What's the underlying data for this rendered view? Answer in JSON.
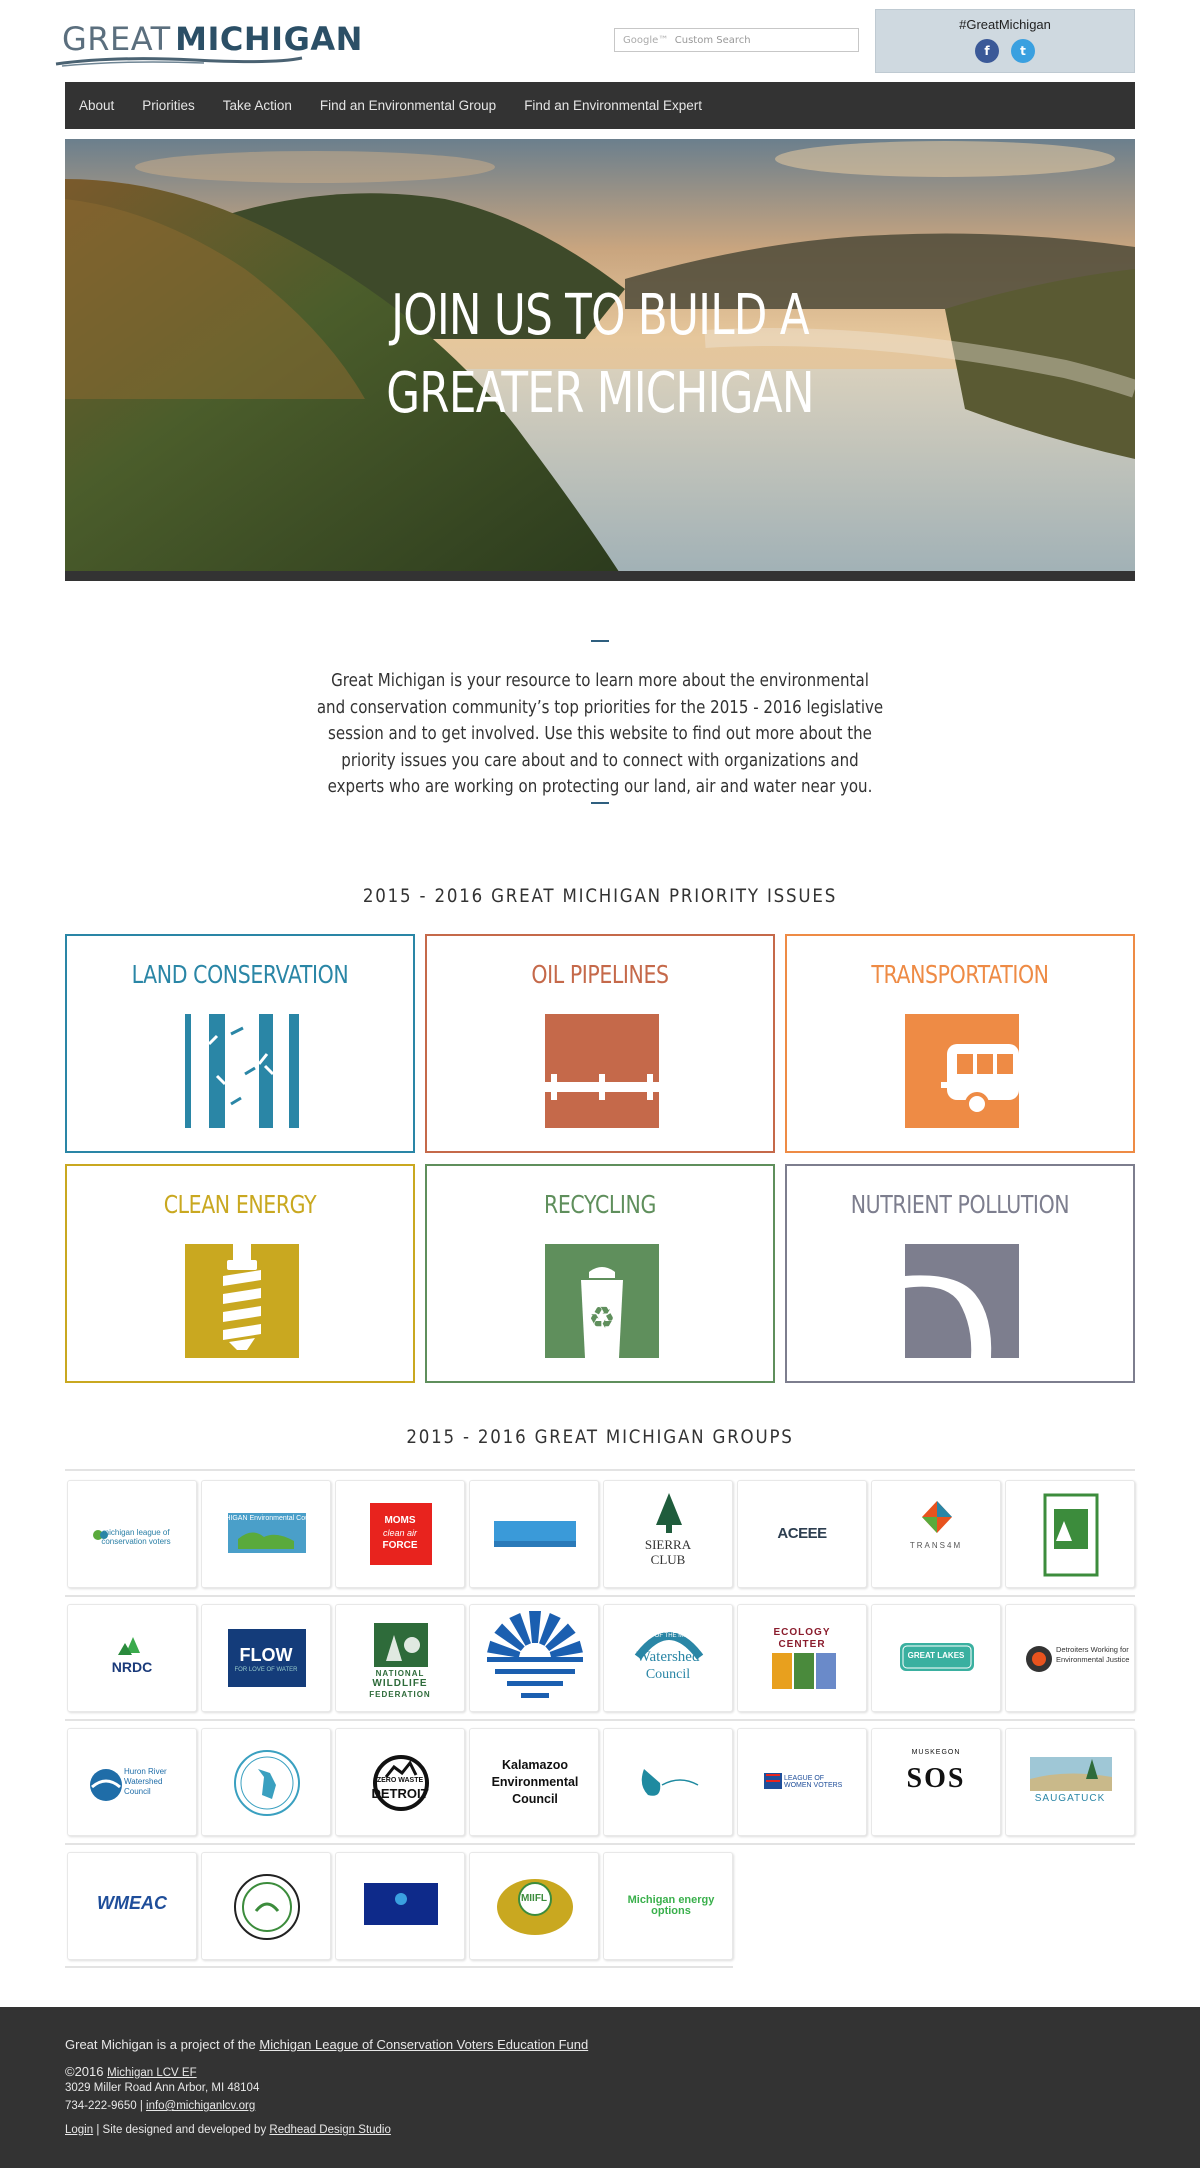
{
  "header": {
    "logo_great": "GREAT",
    "logo_michigan": "MICHIGAN",
    "search_placeholder": "Custom Search",
    "search_brand": "Google™",
    "hashtag": "#GreatMichigan",
    "social": [
      "f",
      "t"
    ]
  },
  "nav": [
    "About",
    "Priorities",
    "Take Action",
    "Find an Environmental Group",
    "Find an Environmental Expert"
  ],
  "hero": {
    "line1": "JOIN US TO BUILD A",
    "line2": "GREATER MICHIGAN"
  },
  "intro": "Great Michigan is your resource to learn more about the environmental and conservation community’s top priorities for the 2015 - 2016 legislative session and to get involved. Use this website to find out more about the priority issues you care about and to connect with organizations and experts who are working on protecting our land, air and water near you.",
  "priorities": {
    "title": "2015 - 2016 GREAT MICHIGAN PRIORITY ISSUES",
    "items": [
      {
        "label": "LAND CONSERVATION",
        "color": "#2a86a6",
        "icon": "trees-icon"
      },
      {
        "label": "OIL PIPELINES",
        "color": "#c5694a",
        "icon": "pipeline-icon"
      },
      {
        "label": "TRANSPORTATION",
        "color": "#ee8b45",
        "icon": "bus-icon"
      },
      {
        "label": "CLEAN ENERGY",
        "color": "#c9a820",
        "icon": "lightbulb-icon"
      },
      {
        "label": "RECYCLING",
        "color": "#5f8f5c",
        "icon": "recycle-bin-icon"
      },
      {
        "label": "NUTRIENT POLLUTION",
        "color": "#7d7e8e",
        "icon": "river-icon"
      }
    ]
  },
  "groups": {
    "title": "2015 - 2016 GREAT MICHIGAN GROUPS",
    "logo_text": {
      "moms1": "MOMS",
      "moms2": "clean air",
      "moms3": "FORCE",
      "sierra1": "SIERRA",
      "sierra2": "CLUB",
      "aceee": "ACEEE",
      "transform": "TRANS4M",
      "nrdc": "NRDC",
      "flow": "FLOW",
      "flow_sub": "FOR LOVE OF WATER",
      "nwf1": "NATIONAL",
      "nwf2": "WILDLIFE",
      "nwf3": "FEDERATION",
      "tip1": "TIP OF THE MITT",
      "tip2": "Watershed",
      "tip3": "Council",
      "ecology1": "ECOLOGY",
      "ecology2": "CENTER",
      "greatlakes": "GREAT LAKES",
      "detroiters": "Detroiters Working for Environmental Justice",
      "huron": "Huron River Watershed Council",
      "zerowaste1": "ZERO WASTE",
      "zerowaste2": "DETROIT",
      "kalamazoo": "Kalamazoo Environmental Council",
      "lwv": "LEAGUE OF WOMEN VOTERS",
      "sos": "SOS",
      "muskegon": "MUSKEGON",
      "saugatuck": "SAUGATUCK",
      "wmeac": "WMEAC",
      "michigan_energy": "Michigan energy options",
      "mlcv": "michigan league of conservation voters",
      "mec": "MICHIGAN Environmental Council",
      "miifl": "MIIFL"
    }
  },
  "footer": {
    "project_prefix": "Great Michigan is a project of the ",
    "project_link": "Michigan League of Conservation Voters Education Fund",
    "copyright": "©2016",
    "org_link": "Michigan LCV EF",
    "address": "3029 Miller Road Ann Arbor, MI 48104",
    "phone": "734-222-9650",
    "email": "info@michiganlcv.org",
    "login": "Login",
    "credit_prefix": " | Site designed and developed by ",
    "credit_link": "Redhead Design Studio"
  }
}
